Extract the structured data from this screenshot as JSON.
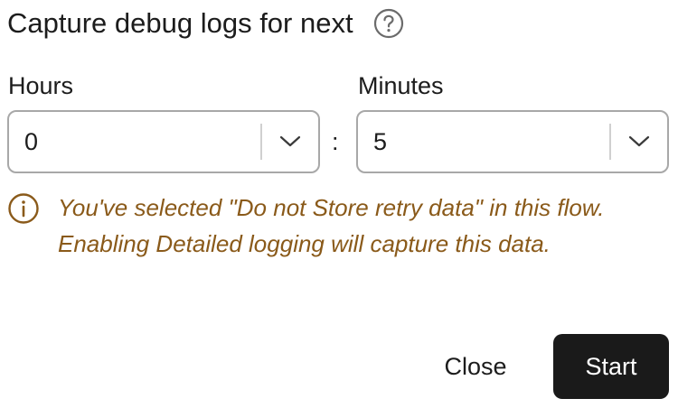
{
  "dialog": {
    "title": "Capture debug logs for next",
    "help_icon": "question-circle-icon"
  },
  "fields": {
    "hours": {
      "label": "Hours",
      "value": "0",
      "icon": "chevron-down-icon"
    },
    "separator": ":",
    "minutes": {
      "label": "Minutes",
      "value": "5",
      "icon": "chevron-down-icon"
    }
  },
  "warning": {
    "icon": "info-circle-icon",
    "text": "You've selected \"Do not Store retry data\" in this flow. Enabling Detailed logging will capture this data.",
    "color": "#8a5a1a"
  },
  "actions": {
    "close_label": "Close",
    "start_label": "Start",
    "start_bg": "#1a1a1a"
  }
}
